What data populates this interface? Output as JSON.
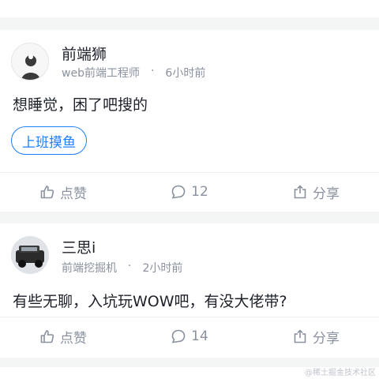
{
  "posts": [
    {
      "author": "前端狮",
      "title": "web前端工程师",
      "time": "6小时前",
      "content": "想睡觉，困了吧搜的",
      "tag": "上班摸鱼",
      "actions": {
        "like": "点赞",
        "comments": "12",
        "share": "分享"
      }
    },
    {
      "author": "三思i",
      "title": "前端挖掘机",
      "time": "2小时前",
      "content": "有些无聊，入坑玩WOW吧，有没大佬带?",
      "actions": {
        "like": "点赞",
        "comments": "14",
        "share": "分享"
      }
    }
  ],
  "separator": "·",
  "watermark": "@稀土掘金技术社区",
  "colors": {
    "accent": "#1e80ff",
    "muted": "#8a919f",
    "background": "#f4f5f5"
  }
}
